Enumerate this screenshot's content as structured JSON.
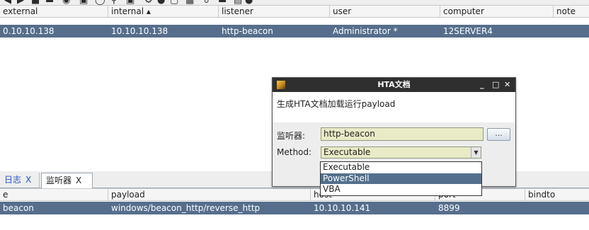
{
  "toolbar": {
    "icons": [
      "back-icon",
      "forward-icon",
      "new-connection-icon",
      "minus-icon",
      "headphones-icon",
      "image-icon",
      "camera-icon",
      "key-icon",
      "picture-icon",
      "gear-icon",
      "coffee-icon",
      "doc-icon",
      "save-icon",
      "link-icon",
      "cube-icon",
      "book-icon",
      "cloud-icon"
    ]
  },
  "top_table": {
    "columns": [
      "external",
      "internal ▴",
      "listener",
      "user",
      "computer",
      "note"
    ],
    "rows": [
      [
        "0.10.10.138",
        "10.10.10.138",
        "http-beacon",
        "Administrator *",
        "12SERVER4",
        ""
      ]
    ]
  },
  "tabs": [
    {
      "label": "日志",
      "close": "X"
    },
    {
      "label": "监听器",
      "close": "X"
    }
  ],
  "bottom_table": {
    "columns": [
      "e",
      "payload",
      "host",
      "port",
      "bindto"
    ],
    "rows": [
      [
        "beacon",
        "windows/beacon_http/reverse_http",
        "10.10.10.141",
        "8899",
        ""
      ]
    ]
  },
  "dialog": {
    "title": "HTA文档",
    "min_label": "_",
    "max_label": "□",
    "close_label": "✕",
    "description": "生成HTA文档加载运行payload",
    "listener_label": "监听器:",
    "listener_value": "http-beacon",
    "browse_label": "...",
    "method_label": "Method:",
    "method_value": "Executable",
    "options": [
      "Executable",
      "PowerShell",
      "VBA"
    ],
    "highlighted_option": "PowerShell"
  },
  "colors": {
    "selection": "#566e8c",
    "dialog_title_bg": "#2f2f2f",
    "field_bg": "#e9eac6"
  }
}
